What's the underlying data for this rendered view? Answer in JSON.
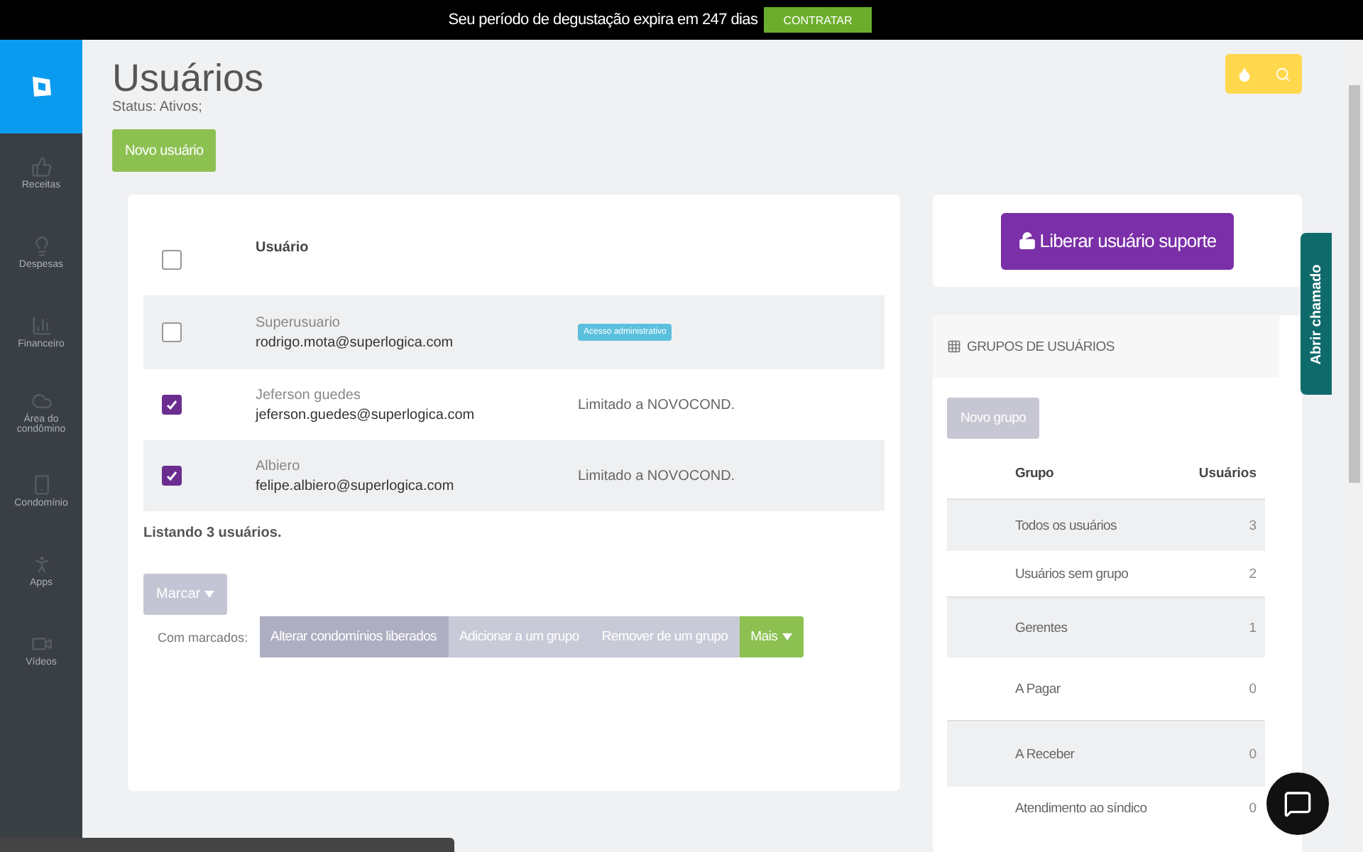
{
  "trial_banner": {
    "text": "Seu período de degustação expira em 247 dias",
    "button": "CONTRATAR"
  },
  "sidebar": {
    "items": [
      {
        "label": "Receitas"
      },
      {
        "label": "Despesas"
      },
      {
        "label": "Financeiro"
      },
      {
        "label": "Área do condômino"
      },
      {
        "label": "Condomínio"
      },
      {
        "label": "Apps"
      },
      {
        "label": "Vídeos"
      }
    ]
  },
  "page": {
    "title": "Usuários",
    "status": "Status: Ativos;",
    "new_button": "Novo usuário"
  },
  "users_table": {
    "column": "Usuário",
    "header_checked": false,
    "rows": [
      {
        "name": "Superusuario",
        "email": "rodrigo.mota@superlogica.com",
        "kind": "badge",
        "access": "Acesso administrativo",
        "checked": false
      },
      {
        "name": "Jeferson guedes",
        "email": "jeferson.guedes@superlogica.com",
        "kind": "text",
        "access": "Limitado a NOVOCOND.",
        "checked": true
      },
      {
        "name": "Albiero",
        "email": "felipe.albiero@superlogica.com",
        "kind": "text",
        "access": "Limitado a NOVOCOND.",
        "checked": true
      }
    ],
    "footer": "Listando 3 usuários."
  },
  "bulk": {
    "mark_button": "Marcar",
    "label": "Com marcados:",
    "actions": [
      {
        "label": "Alterar condomínios liberados",
        "kind": "action",
        "hovered": true
      },
      {
        "label": "Adicionar a um grupo",
        "kind": "action",
        "hovered": false
      },
      {
        "label": "Remover de um grupo",
        "kind": "action",
        "hovered": false
      },
      {
        "label": "Mais",
        "kind": "menu",
        "hovered": false
      }
    ]
  },
  "support": {
    "button": "Liberar usuário suporte"
  },
  "groups": {
    "title": "GRUPOS DE USUÁRIOS",
    "new_button": "Novo grupo",
    "columns": [
      "Grupo",
      "Usuários"
    ],
    "rows": [
      {
        "name": "Todos os usuários",
        "count": "3"
      },
      {
        "name": "Usuários sem grupo",
        "count": "2"
      },
      {
        "name": "Gerentes",
        "count": "1"
      },
      {
        "name": "A Pagar",
        "count": "0"
      },
      {
        "name": "A Receber",
        "count": "0"
      },
      {
        "name": "Atendimento ao síndico",
        "count": "0"
      }
    ]
  },
  "ticket_tab": "Abrir chamado"
}
